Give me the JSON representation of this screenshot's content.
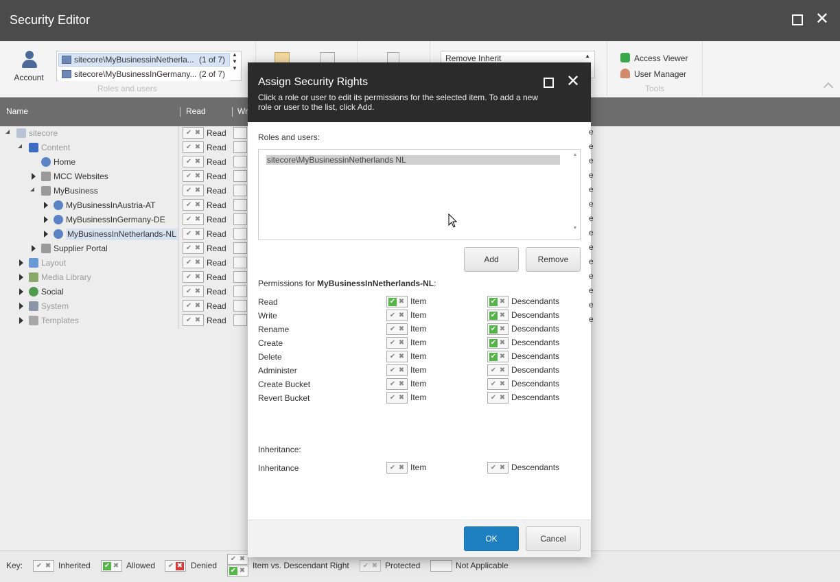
{
  "window": {
    "title": "Security Editor"
  },
  "ribbon": {
    "account_label": "Account",
    "roles": [
      {
        "name": "sitecore\\MyBusinessinNetherla...",
        "count": "(1 of 7)"
      },
      {
        "name": "sitecore\\MyBusinessInGermany...",
        "count": "(2 of 7)"
      }
    ],
    "roles_group_label": "Roles and users",
    "inherit_value": "Remove Inherit",
    "tools": {
      "access_viewer": "Access Viewer",
      "user_manager": "User Manager",
      "group_label": "Tools"
    }
  },
  "grid": {
    "columns": [
      "Name",
      "Read",
      "Wr"
    ],
    "perm_label": "Read",
    "rows": [
      {
        "label": "sitecore",
        "icon": "page-icon",
        "dim": true,
        "toggle": "expanded"
      },
      {
        "label": "Content",
        "icon": "content-icon",
        "dim": true,
        "toggle": "expanded"
      },
      {
        "label": "Home",
        "icon": "globe-icon",
        "dim": false,
        "toggle": "none"
      },
      {
        "label": "MCC Websites",
        "icon": "building-icon",
        "dim": false,
        "toggle": "collapsed"
      },
      {
        "label": "MyBusiness",
        "icon": "building-icon",
        "dim": false,
        "toggle": "expanded"
      },
      {
        "label": "MyBusinessInAustria-AT",
        "icon": "globe-icon",
        "dim": false,
        "toggle": "collapsed"
      },
      {
        "label": "MyBusinessInGermany-DE",
        "icon": "globe-icon",
        "dim": false,
        "toggle": "collapsed"
      },
      {
        "label": "MyBusinessInNetherlands-NL",
        "icon": "globe-icon",
        "dim": false,
        "toggle": "collapsed",
        "selected": true
      },
      {
        "label": "Supplier Portal",
        "icon": "building-icon",
        "dim": false,
        "toggle": "collapsed"
      },
      {
        "label": "Layout",
        "icon": "layout-icon",
        "dim": true,
        "toggle": "collapsed"
      },
      {
        "label": "Media Library",
        "icon": "image-icon",
        "dim": true,
        "toggle": "collapsed"
      },
      {
        "label": "Social",
        "icon": "social-icon",
        "dim": false,
        "toggle": "collapsed"
      },
      {
        "label": "System",
        "icon": "system-icon",
        "dim": true,
        "toggle": "collapsed"
      },
      {
        "label": "Templates",
        "icon": "template-icon",
        "dim": true,
        "toggle": "collapsed"
      }
    ],
    "right_e_rows": [
      "e",
      "e",
      "e",
      "e",
      "e",
      "e",
      "e",
      "e",
      "e",
      "e",
      "e",
      "e",
      "e",
      "e"
    ]
  },
  "dialog": {
    "title": "Assign Security Rights",
    "description": "Click a role or user to edit its permissions for the selected item. To add a new role or user to the list, click Add.",
    "roles_label": "Roles and users:",
    "roles": [
      "sitecore\\MyBusinessinNetherlands NL"
    ],
    "add_button": "Add",
    "remove_button": "Remove",
    "permissions_prefix": "Permissions for ",
    "permissions_item": "MyBusinessInNetherlands-NL",
    "permissions_suffix": ":",
    "item_label": "Item",
    "descendants_label": "Descendants",
    "permissions": [
      {
        "name": "Read",
        "item": "allowed",
        "descendants": "allowed"
      },
      {
        "name": "Write",
        "item": "inherited",
        "descendants": "allowed"
      },
      {
        "name": "Rename",
        "item": "inherited",
        "descendants": "allowed"
      },
      {
        "name": "Create",
        "item": "inherited",
        "descendants": "allowed"
      },
      {
        "name": "Delete",
        "item": "inherited",
        "descendants": "allowed"
      },
      {
        "name": "Administer",
        "item": "inherited",
        "descendants": "inherited"
      },
      {
        "name": "Create Bucket",
        "item": "inherited",
        "descendants": "inherited"
      },
      {
        "name": "Revert Bucket",
        "item": "inherited",
        "descendants": "inherited"
      }
    ],
    "inheritance_heading": "Inheritance:",
    "inheritance_row": {
      "name": "Inheritance",
      "item": "inherited",
      "descendants": "inherited"
    },
    "ok_button": "OK",
    "cancel_button": "Cancel"
  },
  "key": {
    "label": "Key:",
    "inherited": "Inherited",
    "allowed": "Allowed",
    "denied": "Denied",
    "item_vs_desc": "Item vs. Descendant Right",
    "protected": "Protected",
    "not_applicable": "Not Applicable"
  },
  "colors": {
    "titlebar": "#4b4b4b",
    "dialog_header": "#2b2b2b",
    "allowed_green": "#55b548",
    "denied_red": "#d93a3a",
    "ok_blue": "#1e7fc1"
  }
}
